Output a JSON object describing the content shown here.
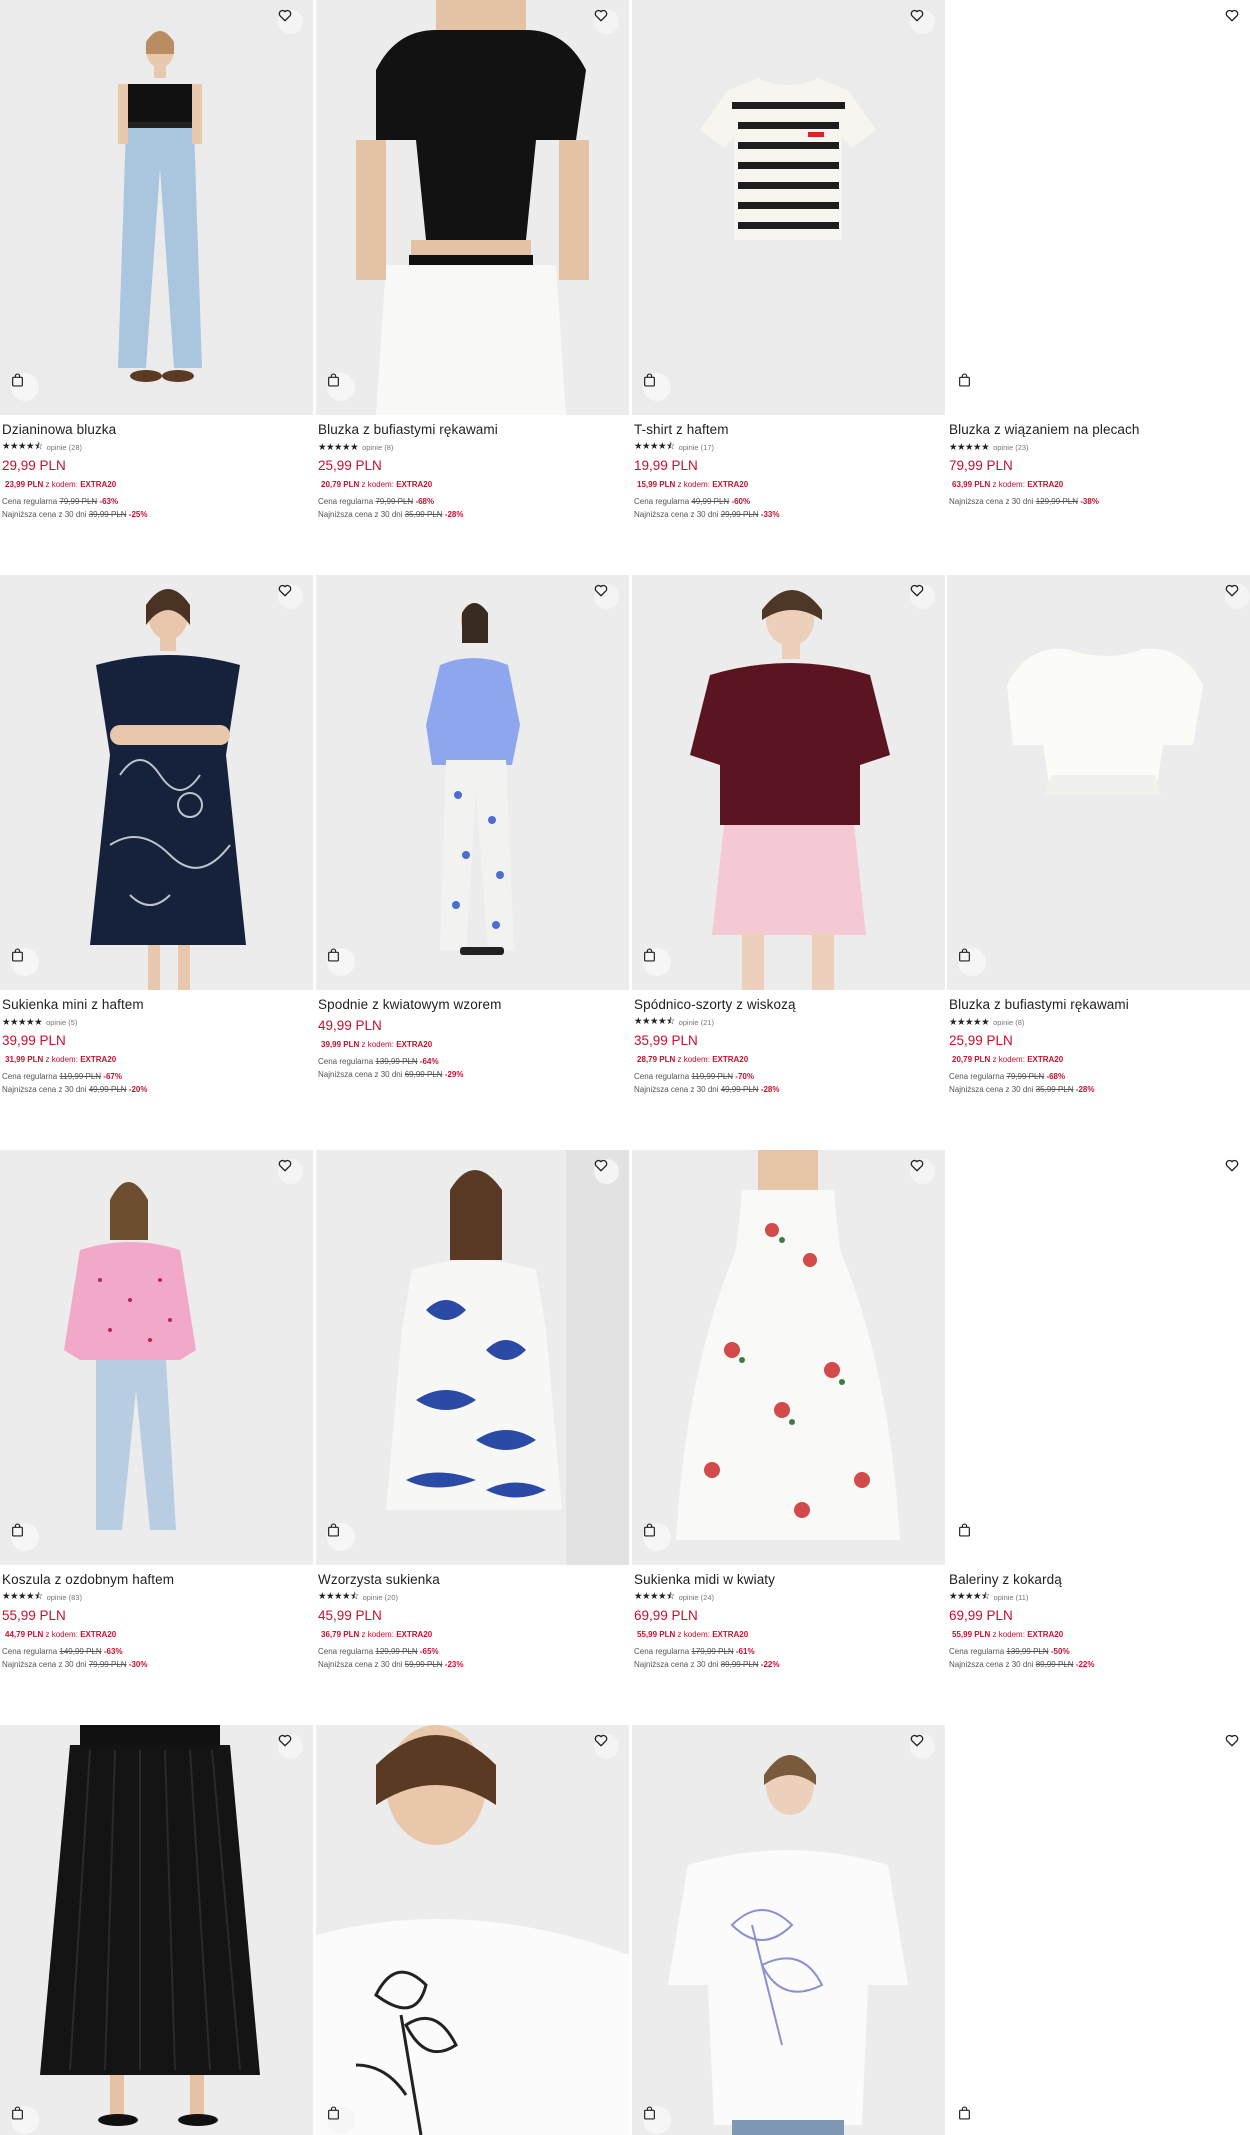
{
  "products": [
    {
      "name": "Dzianinowa bluzka",
      "stars": "★★★★⯪",
      "reviews": "opinie (28)",
      "price": "29,99 PLN",
      "promo_price": "23,99 PLN",
      "promo_text": "z kodem:",
      "promo_code": "EXTRA20",
      "regular_label": "Cena regularna",
      "regular_price": "79,99 PLN",
      "regular_pct": "-63%",
      "lowest_label": "Najniższa cena z 30 dni",
      "lowest_price": "39,99 PLN",
      "lowest_pct": "-25%",
      "image": "woman-black-top-jeans"
    },
    {
      "name": "Bluzka z bufiastymi rękawami",
      "stars": "★★★★★",
      "reviews": "opinie (8)",
      "price": "25,99 PLN",
      "promo_price": "20,79 PLN",
      "promo_text": "z kodem:",
      "promo_code": "EXTRA20",
      "regular_label": "Cena regularna",
      "regular_price": "79,99 PLN",
      "regular_pct": "-68%",
      "lowest_label": "Najniższa cena z 30 dni",
      "lowest_price": "35,99 PLN",
      "lowest_pct": "-28%",
      "image": "black-puff-sleeve-top"
    },
    {
      "name": "T-shirt z haftem",
      "stars": "★★★★⯪",
      "reviews": "opinie (17)",
      "price": "19,99 PLN",
      "promo_price": "15,99 PLN",
      "promo_text": "z kodem:",
      "promo_code": "EXTRA20",
      "regular_label": "Cena regularna",
      "regular_price": "49,99 PLN",
      "regular_pct": "-60%",
      "lowest_label": "Najniższa cena z 30 dni",
      "lowest_price": "29,99 PLN",
      "lowest_pct": "-33%",
      "image": "striped-tshirt"
    },
    {
      "name": "Bluzka z wiązaniem na plecach",
      "stars": "★★★★★",
      "reviews": "opinie (23)",
      "price": "79,99 PLN",
      "promo_price": "63,99 PLN",
      "promo_text": "z kodem:",
      "promo_code": "EXTRA20",
      "regular_label": "",
      "regular_price": "",
      "regular_pct": "",
      "lowest_label": "Najniższa cena z 30 dni",
      "lowest_price": "129,99 PLN",
      "lowest_pct": "-38%",
      "image": ""
    },
    {
      "name": "Sukienka mini z haftem",
      "stars": "★★★★★",
      "reviews": "opinie (5)",
      "price": "39,99 PLN",
      "promo_price": "31,99 PLN",
      "promo_text": "z kodem:",
      "promo_code": "EXTRA20",
      "regular_label": "Cena regularna",
      "regular_price": "119,99 PLN",
      "regular_pct": "-67%",
      "lowest_label": "Najniższa cena z 30 dni",
      "lowest_price": "49,99 PLN",
      "lowest_pct": "-20%",
      "image": "navy-floral-mini-dress"
    },
    {
      "name": "Spodnie z kwiatowym wzorem",
      "stars": "",
      "reviews": "",
      "price": "49,99 PLN",
      "promo_price": "39,99 PLN",
      "promo_text": "z kodem:",
      "promo_code": "EXTRA20",
      "regular_label": "Cena regularna",
      "regular_price": "139,99 PLN",
      "regular_pct": "-64%",
      "lowest_label": "Najniższa cena z 30 dni",
      "lowest_price": "69,99 PLN",
      "lowest_pct": "-29%",
      "image": "floral-trousers"
    },
    {
      "name": "Spódnico-szorty z wiskozą",
      "stars": "★★★★⯪",
      "reviews": "opinie (21)",
      "price": "35,99 PLN",
      "promo_price": "28,79 PLN",
      "promo_text": "z kodem:",
      "promo_code": "EXTRA20",
      "regular_label": "Cena regularna",
      "regular_price": "119,99 PLN",
      "regular_pct": "-70%",
      "lowest_label": "Najniższa cena z 30 dni",
      "lowest_price": "49,99 PLN",
      "lowest_pct": "-28%",
      "image": "pink-skort"
    },
    {
      "name": "Bluzka z bufiastymi rękawami",
      "stars": "★★★★★",
      "reviews": "opinie (8)",
      "price": "25,99 PLN",
      "promo_price": "20,79 PLN",
      "promo_text": "z kodem:",
      "promo_code": "EXTRA20",
      "regular_label": "Cena regularna",
      "regular_price": "79,99 PLN",
      "regular_pct": "-68%",
      "lowest_label": "Najniższa cena z 30 dni",
      "lowest_price": "35,99 PLN",
      "lowest_pct": "-28%",
      "image": "white-puff-sleeve-top"
    },
    {
      "name": "Koszula z ozdobnym haftem",
      "stars": "★★★★⯪",
      "reviews": "opinie (83)",
      "price": "55,99 PLN",
      "promo_price": "44,79 PLN",
      "promo_text": "z kodem:",
      "promo_code": "EXTRA20",
      "regular_label": "Cena regularna",
      "regular_price": "149,99 PLN",
      "regular_pct": "-63%",
      "lowest_label": "Najniższa cena z 30 dni",
      "lowest_price": "79,99 PLN",
      "lowest_pct": "-30%",
      "image": "pink-shirt"
    },
    {
      "name": "Wzorzysta sukienka",
      "stars": "★★★★⯪",
      "reviews": "opinie (20)",
      "price": "45,99 PLN",
      "promo_price": "36,79 PLN",
      "promo_text": "z kodem:",
      "promo_code": "EXTRA20",
      "regular_label": "Cena regularna",
      "regular_price": "129,99 PLN",
      "regular_pct": "-65%",
      "lowest_label": "Najniższa cena z 30 dni",
      "lowest_price": "59,99 PLN",
      "lowest_pct": "-23%",
      "image": "blue-pattern-dress"
    },
    {
      "name": "Sukienka midi w kwiaty",
      "stars": "★★★★⯪",
      "reviews": "opinie (24)",
      "price": "69,99 PLN",
      "promo_price": "55,99 PLN",
      "promo_text": "z kodem:",
      "promo_code": "EXTRA20",
      "regular_label": "Cena regularna",
      "regular_price": "179,99 PLN",
      "regular_pct": "-61%",
      "lowest_label": "Najniższa cena z 30 dni",
      "lowest_price": "89,99 PLN",
      "lowest_pct": "-22%",
      "image": "rose-midi-dress"
    },
    {
      "name": "Baleriny z kokardą",
      "stars": "★★★★⯪",
      "reviews": "opinie (11)",
      "price": "69,99 PLN",
      "promo_price": "55,99 PLN",
      "promo_text": "z kodem:",
      "promo_code": "EXTRA20",
      "regular_label": "Cena regularna",
      "regular_price": "139,99 PLN",
      "regular_pct": "-50%",
      "lowest_label": "Najniższa cena z 30 dni",
      "lowest_price": "89,99 PLN",
      "lowest_pct": "-22%",
      "image": ""
    },
    {
      "name": "",
      "image": "black-pleated-skirt"
    },
    {
      "name": "",
      "image": "white-tshirt-floral-print"
    },
    {
      "name": "",
      "image": "white-tshirt-sketch"
    },
    {
      "name": "",
      "image": ""
    }
  ],
  "icons": {
    "wishlist": "heart-icon",
    "cart": "shopping-bag-icon"
  },
  "colors": {
    "sale_red": "#c8102e",
    "photo_bg": "#ececec"
  }
}
